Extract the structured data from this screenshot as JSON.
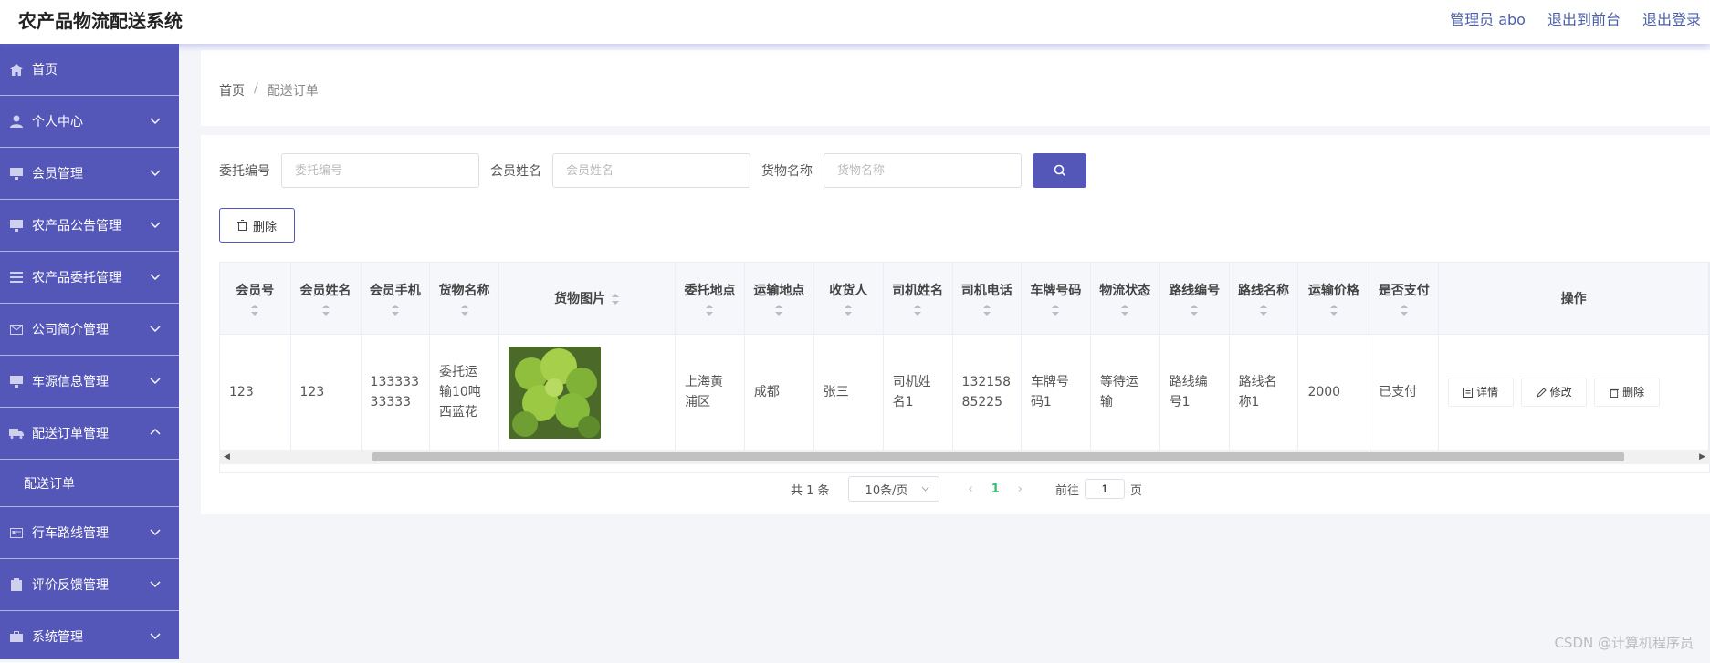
{
  "header": {
    "title": "农产品物流配送系统",
    "links": [
      "管理员 abo",
      "退出到前台",
      "退出登录"
    ]
  },
  "sidebar": {
    "items": [
      {
        "label": "首页",
        "icon": "home-icon"
      },
      {
        "label": "个人中心",
        "icon": "user-icon"
      },
      {
        "label": "会员管理",
        "icon": "monitor-icon"
      },
      {
        "label": "农产品公告管理",
        "icon": "monitor-icon"
      },
      {
        "label": "农产品委托管理",
        "icon": "list-icon"
      },
      {
        "label": "公司简介管理",
        "icon": "mail-icon"
      },
      {
        "label": "车源信息管理",
        "icon": "monitor-icon"
      },
      {
        "label": "配送订单管理",
        "icon": "truck-icon"
      },
      {
        "label": "行车路线管理",
        "icon": "id-card-icon"
      },
      {
        "label": "评价反馈管理",
        "icon": "clipboard-icon"
      },
      {
        "label": "系统管理",
        "icon": "briefcase-icon"
      }
    ],
    "sub_item": "配送订单"
  },
  "breadcrumb": {
    "home": "首页",
    "current": "配送订单"
  },
  "search": {
    "fields": [
      {
        "label": "委托编号",
        "placeholder": "委托编号"
      },
      {
        "label": "会员姓名",
        "placeholder": "会员姓名"
      },
      {
        "label": "货物名称",
        "placeholder": "货物名称"
      }
    ]
  },
  "toolbar": {
    "delete_label": "删除"
  },
  "table": {
    "headers": [
      "会员号",
      "会员姓名",
      "会员手机",
      "货物名称",
      "货物图片",
      "委托地点",
      "运输地点",
      "收货人",
      "司机姓名",
      "司机电话",
      "车牌号码",
      "物流状态",
      "路线编号",
      "路线名称",
      "运输价格",
      "是否支付",
      "操作"
    ],
    "rows": [
      {
        "cells": [
          "123",
          "123",
          "13333333333",
          "委托运输10吨西蓝花",
          "",
          "上海黄浦区",
          "成都",
          "张三",
          "司机姓名1",
          "13215885225",
          "车牌号码1",
          "等待运输",
          "路线编号1",
          "路线名称1",
          "2000",
          "已支付"
        ],
        "actions": [
          "详情",
          "修改",
          "删除"
        ]
      }
    ]
  },
  "pagination": {
    "total_text": "共 1 条",
    "page_size": "10条/页",
    "current_page": "1",
    "goto_prefix": "前往",
    "goto_value": "1",
    "goto_suffix": "页"
  },
  "watermark": "CSDN @计算机程序员",
  "colors": {
    "accent": "#5457b8",
    "active_page": "#3cb878"
  }
}
